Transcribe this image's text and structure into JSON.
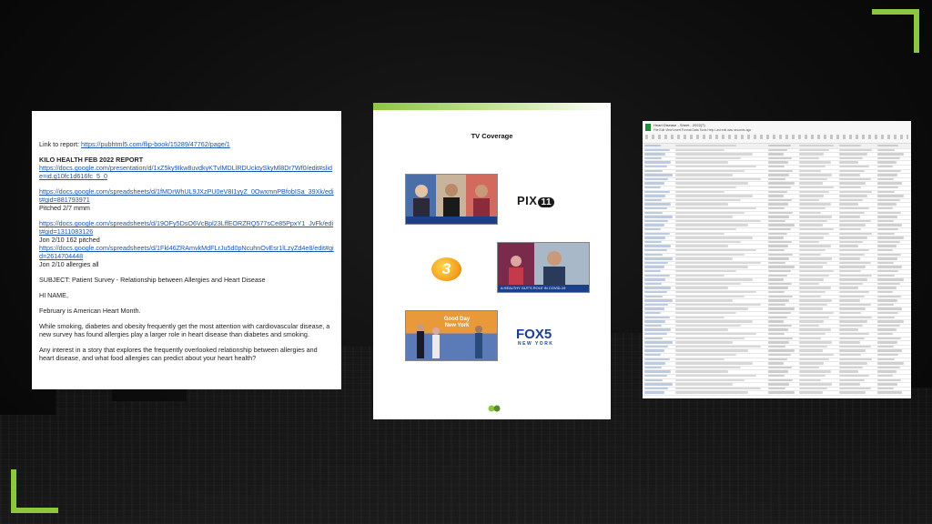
{
  "colors": {
    "accent": "#8dc63f",
    "link": "#1a55b0",
    "fox_blue": "#1d3f8f"
  },
  "email_doc": {
    "report_prefix": "Link to report: ",
    "report_link": "https://pubhtml5.com/flip-book/15289/47762/page/1",
    "heading": "KILO HEALTH FEB 2022 REPORT",
    "link1": "https://docs.google.com/presentation/d/1xZ5ky9Ikw8uvdkyKTvlMDLlRDUcktySkyMl8Dr7Wf0/edit#slide=id.g10fc1d616fc_5_0",
    "link2": "https://docs.google.com/spreadsheets/d/1fMDrWhUL9JXzPU0eV8I1yyZ_0OwxmnPBfobISa_39Xk/edit#gid=881793971",
    "pitched": "Pitched 2/7 mmm",
    "link3": "https://docs.google.com/spreadsheets/d/19OFy5DsO6VcBpl23LffEORZRQ577sCe85PpxY1_JvFk/edit#gid=1311083126",
    "jon_pitched": "Jon 2/10 162 pitched",
    "link4": "https://docs.google.com/spreadsheets/d/1Fkl46ZRAmvkMdFLrJu5d0pNcuhnOvEsr1lLzyZd4e8/edit#gid=2614704448",
    "jon_allergies": "Jon 2/10 allergies all",
    "subject": "SUBJECT: Patient Survey - Relationship between Allergies and Heart Disease",
    "greeting": "HI NAME,",
    "para1": "February is American Heart Month.",
    "para2": "While smoking, diabetes and obesity frequently get the most attention with cardiovascular disease, a new survey has found allergies play a larger role in heart disease than diabetes and smoking.",
    "para3": "Any interest in a story that explores the frequently overlooked relationship between allergies and heart disease, and what food allergies can predict about your heart health?"
  },
  "tv_coverage": {
    "title": "TV Coverage",
    "pix_logo": "PIX",
    "pix_pill": "11",
    "channel3": "3",
    "ticker_covid": "A HEALTHY GUT'S ROLE IN COVID-19",
    "goodday": "Good Day New York",
    "fox_logo": "FOX5",
    "fox_sub": "NEW YORK"
  },
  "spreadsheet": {
    "doc_title": "Heart Disease - Sheet - 2022(7)",
    "menu": "File  Edit  View  Insert  Format  Data  Tools  Help  Last edit was seconds ago"
  }
}
